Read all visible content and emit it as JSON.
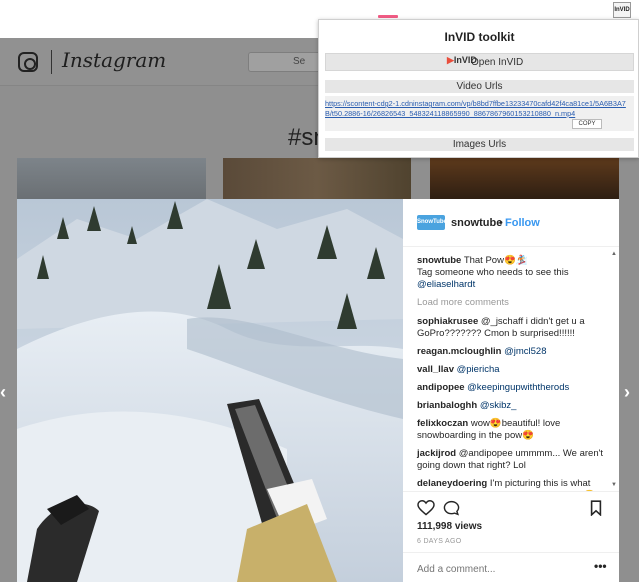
{
  "browser": {
    "extension_badge": "InVID"
  },
  "instagram": {
    "wordmark": "Instagram",
    "search_placeholder": "Se",
    "hashtag": "#sn"
  },
  "post": {
    "user": "snowtube",
    "separator": "•",
    "follow": "Follow",
    "avatar_label": "SnowTube",
    "caption_user": "snowtube",
    "caption_text": "That Pow😍🏂",
    "caption_line2": "Tag someone who needs to see this",
    "caption_mention": "@eliaselhardt",
    "load_more": "Load more comments",
    "comments": [
      {
        "user": "sophiakrusee",
        "text": "@_jschaff i didn't get u a GoPro??????? Cmon b surprised!!!!!!"
      },
      {
        "user": "reagan.mcloughlin",
        "text": "@jmcl528"
      },
      {
        "user": "vall_llav",
        "text": "@piericha"
      },
      {
        "user": "andipopee",
        "text": "@keepingupwiththerods"
      },
      {
        "user": "brianbaloghh",
        "text": "@skibz_"
      },
      {
        "user": "felixkoczan",
        "text": "wow😍beautiful! love snowboarding in the pow😍"
      },
      {
        "user": "jackijrod",
        "text": "@andipopee ummmm... We aren't going down that right? Lol"
      },
      {
        "user": "delaneydoering",
        "text": "I'm picturing this is what your film looks like except upside down 😂@kyleninnemann"
      }
    ],
    "views": "111,998 views",
    "time": "6 DAYS AGO",
    "add_comment_placeholder": "Add a comment...",
    "more": "•••"
  },
  "invid": {
    "title": "InVID toolkit",
    "open_logo": "InVID",
    "open_label": "Open InVID",
    "video_urls_label": "Video Urls",
    "video_url": "https://scontent-cdg2-1.cdninstagram.com/vp/b8bd7ffbe13233470cafd42f4ca81ce1/5A6B3A7B/t50.2886-16/26826543_548324118865990_8867867960153210880_n.mp4",
    "copy_label": "COPY",
    "image_urls_label": "Images Urls"
  },
  "nav": {
    "prev": "‹",
    "next": "›"
  }
}
